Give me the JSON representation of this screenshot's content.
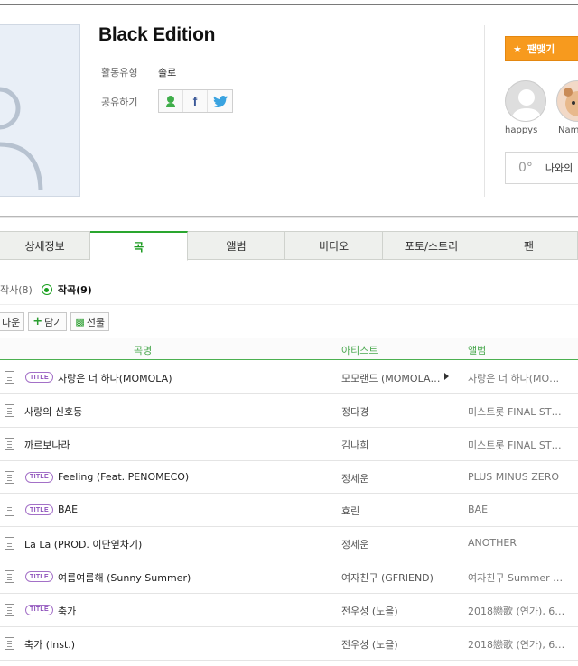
{
  "artist": {
    "name": "Black Edition",
    "type_label": "활동유형",
    "type_value": "솔로",
    "share_label": "공유하기"
  },
  "fan": {
    "button_label": "팬맺기",
    "fans": [
      "happys",
      "Nam"
    ],
    "temperature": "0°",
    "temperature_label": "나와의"
  },
  "tabs": [
    "상세정보",
    "곡",
    "앨범",
    "비디오",
    "포토/스토리",
    "팬"
  ],
  "active_tab": "곡",
  "filter": {
    "writer": "작사(8)",
    "composer": "작곡(9)"
  },
  "actions": {
    "download": "다운",
    "add": "담기",
    "gift": "선물"
  },
  "table": {
    "headers": {
      "song": "곡명",
      "artist": "아티스트",
      "album": "앨범"
    },
    "badge_text": "TITLE",
    "rows": [
      {
        "title": true,
        "song": "사랑은 너 하나(MOMOLA)",
        "artist": "모모랜드 (MOMOLA…",
        "has_more": true,
        "album": "사랑은 너 하나(MO…"
      },
      {
        "title": false,
        "song": "사랑의 신호등",
        "artist": "정다경",
        "has_more": false,
        "album": "미스트롯 FINAL ST…"
      },
      {
        "title": false,
        "song": "까르보나라",
        "artist": "김나희",
        "has_more": false,
        "album": "미스트롯 FINAL ST…"
      },
      {
        "title": true,
        "song": "Feeling (Feat. PENOMECO)",
        "artist": "정세운",
        "has_more": false,
        "album": "PLUS MINUS ZERO"
      },
      {
        "title": true,
        "song": "BAE",
        "artist": "효린",
        "has_more": false,
        "album": "BAE"
      },
      {
        "title": false,
        "song": "La La (PROD. 이단옆차기)",
        "artist": "정세운",
        "has_more": false,
        "album": "ANOTHER"
      },
      {
        "title": true,
        "song": "여름여름해 (Sunny Summer)",
        "artist": "여자친구 (GFRIEND)",
        "has_more": false,
        "album": "여자친구 Summer …"
      },
      {
        "title": true,
        "song": "축가",
        "artist": "전우성 (노을)",
        "has_more": false,
        "album": "2018戀歌 (연가), 6…"
      },
      {
        "title": false,
        "song": "축가 (Inst.)",
        "artist": "전우성 (노을)",
        "has_more": false,
        "album": "2018戀歌 (연가), 6…"
      }
    ]
  },
  "colors": {
    "accent_green": "#2aa62f",
    "fan_orange": "#f79a1e",
    "title_badge_purple": "#8d4fbb"
  }
}
